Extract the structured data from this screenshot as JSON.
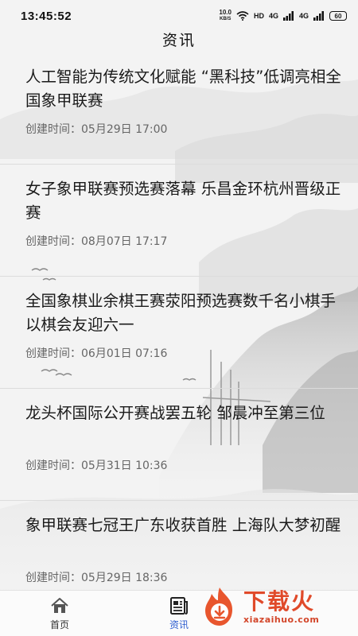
{
  "status_bar": {
    "time": "13:45:52",
    "speed_top": "10.0",
    "speed_bottom": "KB/S",
    "hd_label": "HD",
    "net_label_1": "4G",
    "net_label_2": "4G",
    "battery": "60",
    "icons": [
      "wifi-icon",
      "signal-icon",
      "signal-icon",
      "battery-icon"
    ]
  },
  "header": {
    "title": "资讯"
  },
  "news": [
    {
      "title": "人工智能为传统文化赋能 “黑科技”低调亮相全国象甲联赛",
      "time": "创建时间：05月29日 17:00"
    },
    {
      "title": "女子象甲联赛预选赛落幕 乐昌金环杭州晋级正赛",
      "time": "创建时间：08月07日 17:17"
    },
    {
      "title": "全国象棋业余棋王赛荥阳预选赛数千名小棋手以棋会友迎六一",
      "time": "创建时间：06月01日 07:16"
    },
    {
      "title": "龙头杯国际公开赛战罢五轮 邹晨冲至第三位",
      "time": "创建时间：05月31日 10:36"
    },
    {
      "title": "象甲联赛七冠王广东收获首胜 上海队大梦初醒",
      "time": "创建时间：05月29日 18:36"
    }
  ],
  "tabs": [
    {
      "label": "首页",
      "icon": "home-icon",
      "active": false
    },
    {
      "label": "资讯",
      "icon": "news-icon",
      "active": true
    }
  ],
  "watermark": {
    "main": "下载火",
    "sub": "xiazaihuo.com"
  },
  "colors": {
    "active_tab": "#2f5fd0",
    "watermark": "#e04a2a"
  }
}
